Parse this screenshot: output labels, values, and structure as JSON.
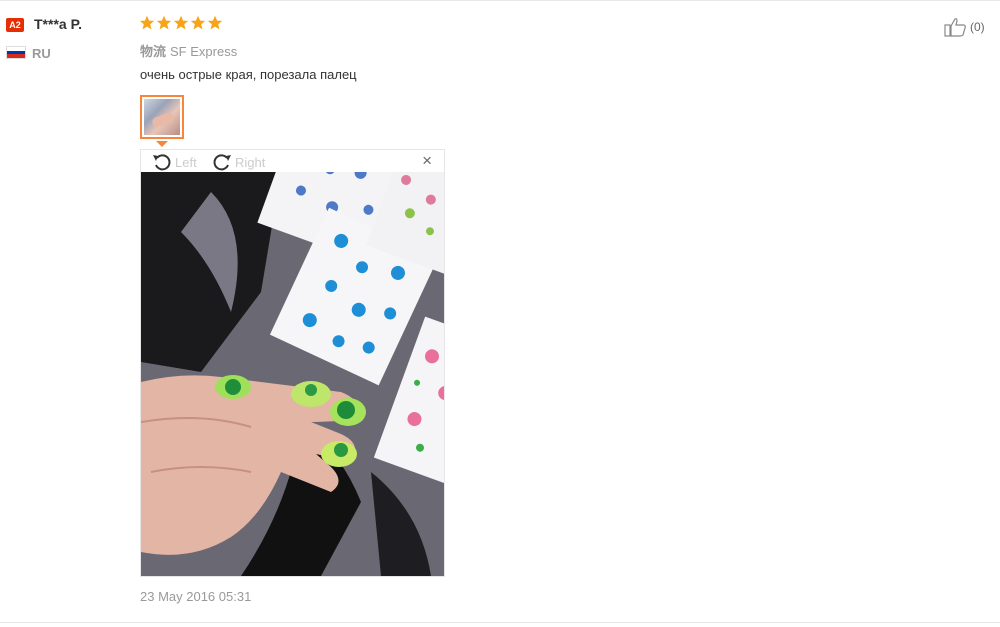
{
  "user": {
    "level_badge": "A2",
    "name": "T***a P.",
    "country_code": "RU",
    "flag_colors": [
      "#ffffff",
      "#0039a6",
      "#d52b1e"
    ],
    "badge_color": "#e62e04"
  },
  "review": {
    "rating": 5,
    "max_rating": 5,
    "star_color": "#f7a418",
    "logistics_label": "物流",
    "logistics_value": "SF Express",
    "text": "очень острые края, порезала палец",
    "date": "23 May 2016 05:31"
  },
  "viewer": {
    "rotate_left_label": "Left",
    "rotate_right_label": "Right",
    "close_glyph": "×",
    "accent_color": "#f7863d"
  },
  "helpful": {
    "count_label": "(0)",
    "icon": "thumbs-up-icon"
  }
}
